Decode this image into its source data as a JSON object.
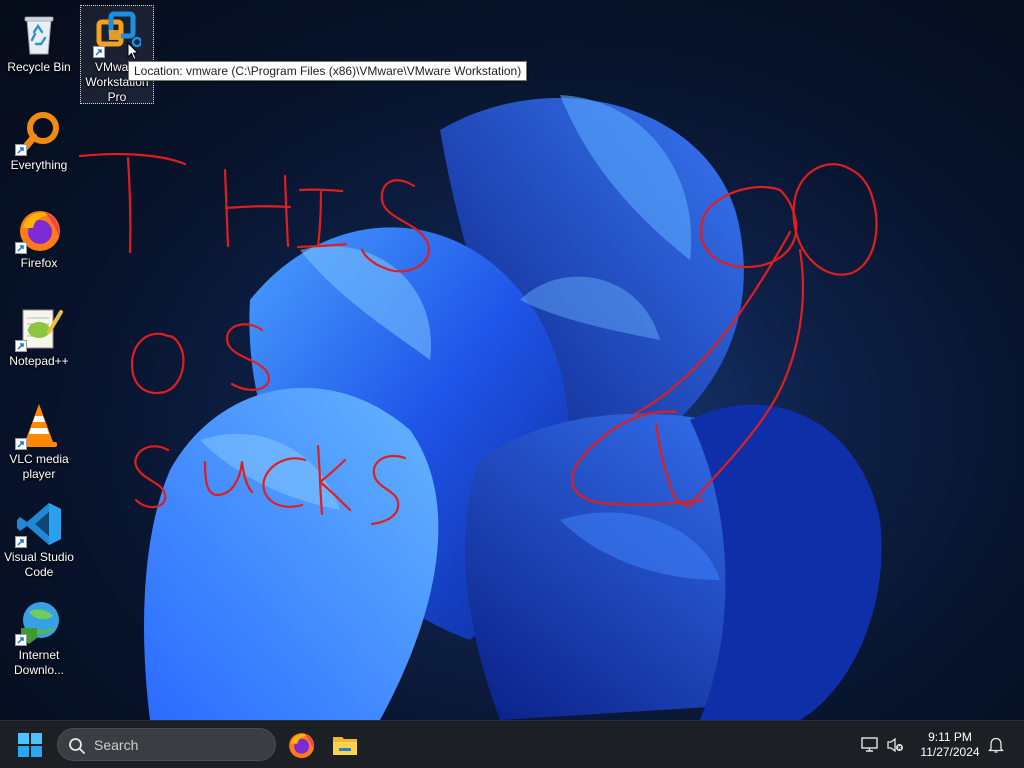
{
  "desktop": {
    "icons": [
      {
        "label": "Recycle Bin",
        "icon": "recycle-bin-icon"
      },
      {
        "label": "VMware Workstation Pro",
        "icon": "vmware-workstation-icon"
      },
      {
        "label": "Everything",
        "icon": "everything-search-icon"
      },
      {
        "label": "Firefox",
        "icon": "firefox-icon"
      },
      {
        "label": "Notepad++",
        "icon": "notepad-plus-plus-icon"
      },
      {
        "label": "VLC media player",
        "icon": "vlc-icon"
      },
      {
        "label": "Visual Studio Code",
        "icon": "vscode-icon"
      },
      {
        "label": "Internet Downlo...",
        "icon": "internet-download-manager-icon"
      }
    ],
    "tooltip": "Location: vmware (C:\\Program Files (x86)\\VMware\\VMware Workstation)",
    "scribble_color": "#e01e1e"
  },
  "taskbar": {
    "search_placeholder": "Search",
    "apps": [
      {
        "name": "Firefox",
        "icon": "firefox-icon"
      },
      {
        "name": "File Explorer",
        "icon": "file-explorer-icon"
      }
    ],
    "time": "9:11 PM",
    "date": "11/27/2024"
  }
}
